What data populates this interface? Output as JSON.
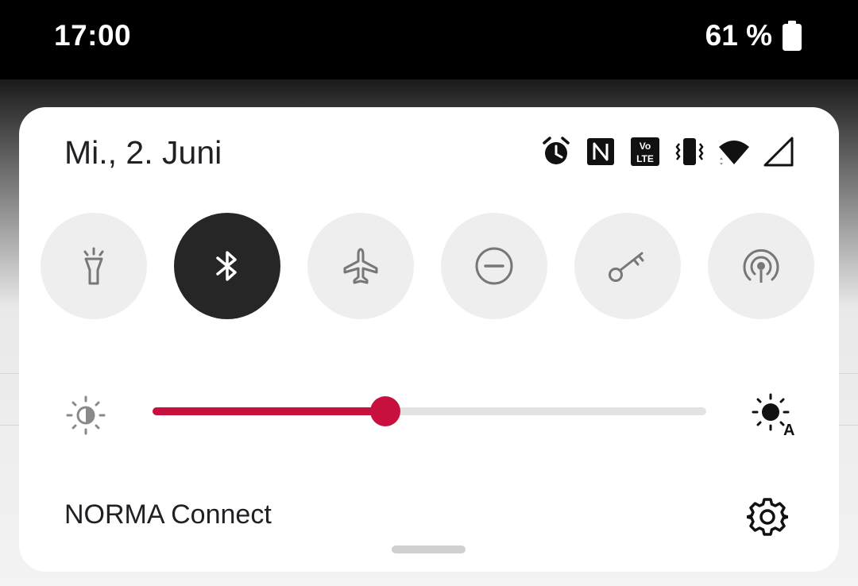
{
  "status_bar": {
    "time": "17:00",
    "battery_text": "61 %",
    "battery_icon": "battery-icon"
  },
  "shade": {
    "date": "Mi., 2. Juni",
    "status_icons": [
      "alarm-icon",
      "nfc-icon",
      "volte-icon",
      "vibrate-icon",
      "wifi-icon",
      "signal-icon"
    ],
    "tiles": [
      {
        "icon": "flashlight-icon",
        "active": false
      },
      {
        "icon": "bluetooth-icon",
        "active": true
      },
      {
        "icon": "airplane-icon",
        "active": false
      },
      {
        "icon": "do-not-disturb-icon",
        "active": false
      },
      {
        "icon": "vpn-key-icon",
        "active": false
      },
      {
        "icon": "hotspot-icon",
        "active": false
      }
    ],
    "brightness": {
      "level_fraction": 0.42,
      "low_icon": "brightness-low-icon",
      "auto_icon": "brightness-auto-icon",
      "auto_label": "A"
    },
    "carrier": "NORMA Connect",
    "settings_icon": "settings-gear-icon"
  },
  "colors": {
    "accent": "#c8103e",
    "tile_inactive": "#eeeeee",
    "tile_active": "#262626"
  }
}
